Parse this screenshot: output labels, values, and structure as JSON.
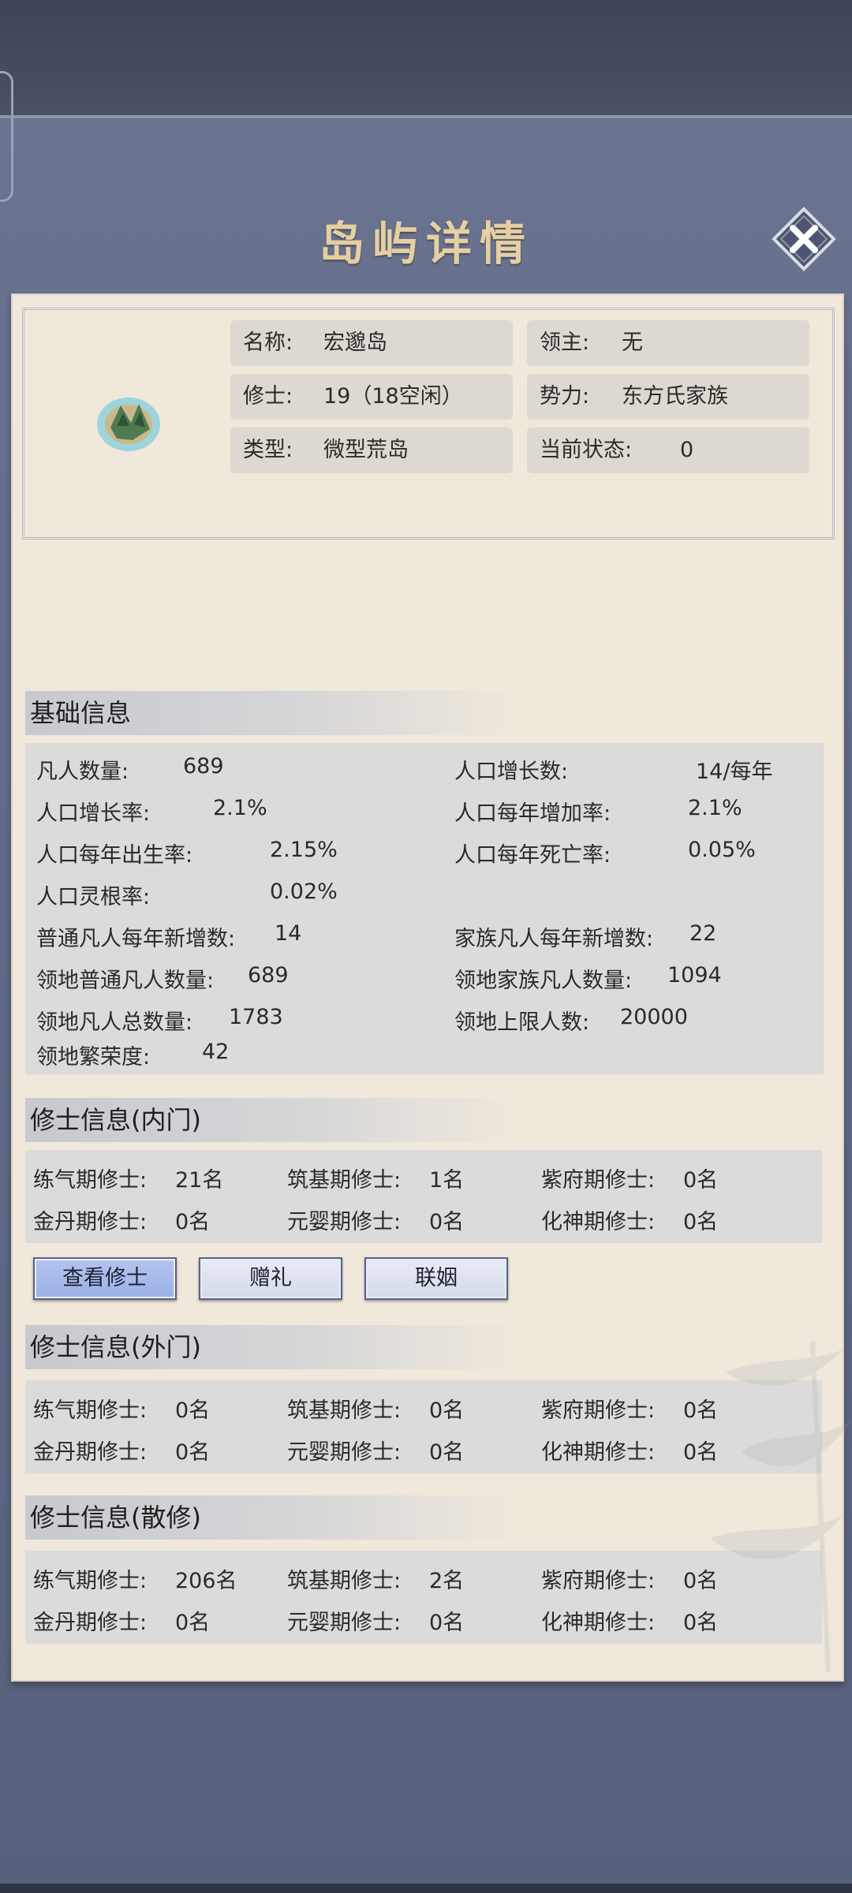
{
  "title": "岛屿详情",
  "island": {
    "name_label": "名称:",
    "name": "宏邈岛",
    "lord_label": "领主:",
    "lord": "无",
    "cultivators_label": "修士:",
    "cultivators": "19（18空闲）",
    "faction_label": "势力:",
    "faction": "东方氏家族",
    "type_label": "类型:",
    "type": "微型荒岛",
    "status_label": "当前状态:",
    "status": "0"
  },
  "basic": {
    "title": "基础信息",
    "rows": [
      {
        "label": "凡人数量:",
        "value": "689"
      },
      {
        "label": "人口增长数:",
        "value": "14/每年"
      },
      {
        "label": "人口增长率:",
        "value": "2.1%"
      },
      {
        "label": "人口每年增加率:",
        "value": "2.1%"
      },
      {
        "label": "人口每年出生率:",
        "value": "2.15%"
      },
      {
        "label": "人口每年死亡率:",
        "value": "0.05%"
      },
      {
        "label": "人口灵根率:",
        "value": "0.02%"
      },
      {
        "label": "普通凡人每年新增数:",
        "value": "14"
      },
      {
        "label": "家族凡人每年新增数:",
        "value": "22"
      },
      {
        "label": "领地普通凡人数量:",
        "value": "689"
      },
      {
        "label": "领地家族凡人数量:",
        "value": "1094"
      },
      {
        "label": "领地凡人总数量:",
        "value": "1783"
      },
      {
        "label": "领地上限人数:",
        "value": "20000"
      },
      {
        "label": "领地繁荣度:",
        "value": "42"
      }
    ]
  },
  "inner": {
    "title": "修士信息(内门)",
    "cells": [
      {
        "label": "练气期修士:",
        "value": "21名"
      },
      {
        "label": "筑基期修士:",
        "value": "1名"
      },
      {
        "label": "紫府期修士:",
        "value": "0名"
      },
      {
        "label": "金丹期修士:",
        "value": "0名"
      },
      {
        "label": "元婴期修士:",
        "value": "0名"
      },
      {
        "label": "化神期修士:",
        "value": "0名"
      }
    ]
  },
  "buttons": {
    "view": "查看修士",
    "gift": "赠礼",
    "marriage": "联姻"
  },
  "outer": {
    "title": "修士信息(外门)",
    "cells": [
      {
        "label": "练气期修士:",
        "value": "0名"
      },
      {
        "label": "筑基期修士:",
        "value": "0名"
      },
      {
        "label": "紫府期修士:",
        "value": "0名"
      },
      {
        "label": "金丹期修士:",
        "value": "0名"
      },
      {
        "label": "元婴期修士:",
        "value": "0名"
      },
      {
        "label": "化神期修士:",
        "value": "0名"
      }
    ]
  },
  "loose": {
    "title": "修士信息(散修)",
    "cells": [
      {
        "label": "练气期修士:",
        "value": "206名"
      },
      {
        "label": "筑基期修士:",
        "value": "2名"
      },
      {
        "label": "紫府期修士:",
        "value": "0名"
      },
      {
        "label": "金丹期修士:",
        "value": "0名"
      },
      {
        "label": "元婴期修士:",
        "value": "0名"
      },
      {
        "label": "化神期修士:",
        "value": "0名"
      }
    ]
  },
  "colors": {
    "title_gold": "#e6cfa0",
    "panel": "#efe8db",
    "button_primary": "#a8bbeb"
  }
}
